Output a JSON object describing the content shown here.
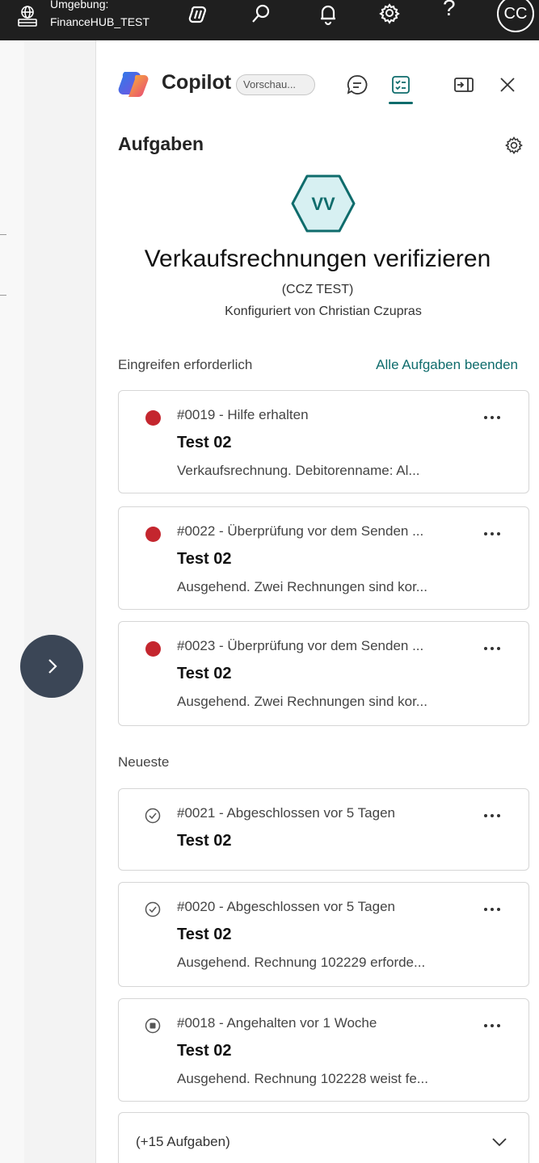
{
  "topbar": {
    "env_label": "Umgebung:",
    "env_name": "FinanceHUB_TEST",
    "help_label": "?",
    "user_initials": "CC",
    "icons": [
      "environment-icon",
      "copilot-icon",
      "search-icon",
      "bell-icon",
      "gear-icon",
      "help-icon"
    ]
  },
  "panel": {
    "title": "Copilot",
    "badge": "Vorschau...",
    "section_title": "Aufgaben",
    "agent": {
      "initials": "VV",
      "name": "Verkaufsrechnungen verifizieren",
      "environment": "(CCZ TEST)",
      "configured_by": "Konfiguriert von Christian Czupras",
      "accent_color": "#0f6c6c",
      "hex_fill": "#d7f0f2"
    },
    "attention": {
      "label": "Eingreifen erforderlich",
      "action": "Alle Aufgaben beenden",
      "tasks": [
        {
          "status": "needs-attention",
          "heading": "#0019 - Hilfe erhalten",
          "title": "Test 02",
          "desc": "Verkaufsrechnung. Debitorenname: Al..."
        },
        {
          "status": "needs-attention",
          "heading": "#0022 - Überprüfung vor dem Senden ...",
          "title": "Test 02",
          "desc": "Ausgehend. Zwei Rechnungen sind kor..."
        },
        {
          "status": "needs-attention",
          "heading": "#0023 - Überprüfung vor dem Senden ...",
          "title": "Test 02",
          "desc": "Ausgehend. Zwei Rechnungen sind kor..."
        }
      ]
    },
    "recent": {
      "label": "Neueste",
      "tasks": [
        {
          "status": "completed",
          "heading": "#0021 - Abgeschlossen vor 5 Tagen",
          "title": "Test 02",
          "desc": ""
        },
        {
          "status": "completed",
          "heading": "#0020 - Abgeschlossen vor 5 Tagen",
          "title": "Test 02",
          "desc": "Ausgehend. Rechnung 102229 erforde..."
        },
        {
          "status": "paused",
          "heading": "#0018 - Angehalten vor 1 Woche",
          "title": "Test 02",
          "desc": "Ausgehend. Rechnung 102228 weist fe..."
        }
      ]
    },
    "more_tasks": "(+15 Aufgaben)",
    "colors": {
      "attention_dot": "#c4262e",
      "expand_button": "#3b4656"
    }
  }
}
